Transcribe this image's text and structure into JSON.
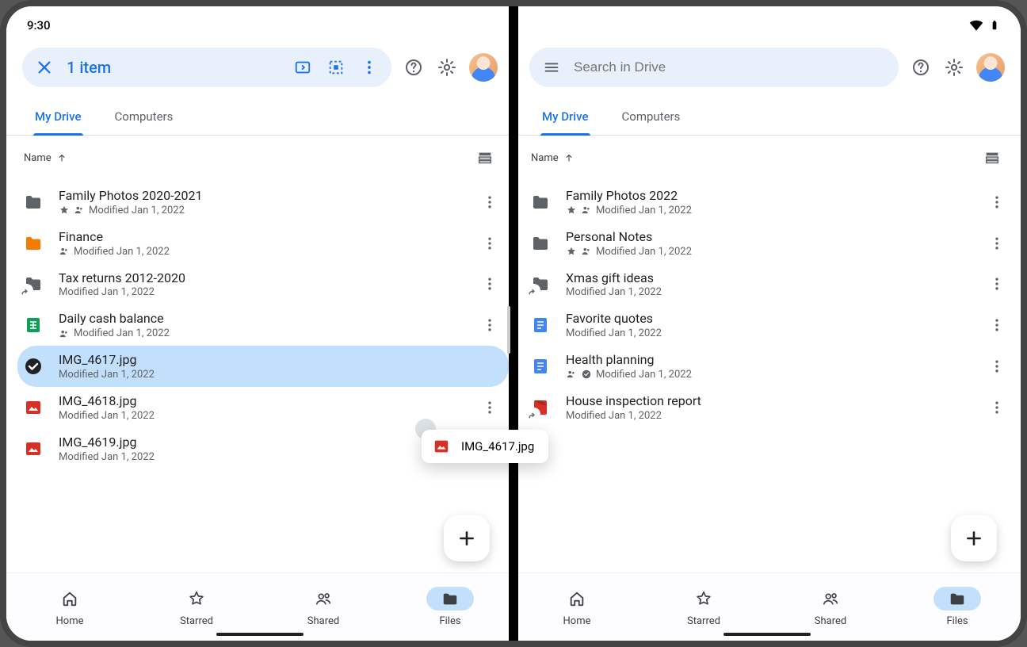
{
  "status": {
    "time": "9:30"
  },
  "left": {
    "selection": {
      "count_label": "1 item"
    },
    "tabs": {
      "drive": "My Drive",
      "computers": "Computers",
      "active": "drive"
    },
    "sort": {
      "label": "Name"
    },
    "files": [
      {
        "title": "Family Photos 2020-2021",
        "sub": "Modified Jan 1, 2022",
        "starred": true,
        "shared": true,
        "type": "folder-grey"
      },
      {
        "title": "Finance",
        "sub": "Modified Jan 1, 2022",
        "starred": false,
        "shared": true,
        "type": "folder-orange"
      },
      {
        "title": "Tax returns 2012-2020",
        "sub": "Modified Jan 1, 2022",
        "starred": false,
        "shared": false,
        "type": "folder-shortcut"
      },
      {
        "title": "Daily cash balance",
        "sub": "Modified Jan 1, 2022",
        "starred": false,
        "shared": true,
        "type": "sheet"
      },
      {
        "title": "IMG_4617.jpg",
        "sub": "Modified Jan 1, 2022",
        "starred": false,
        "shared": false,
        "type": "selected",
        "selected": true
      },
      {
        "title": "IMG_4618.jpg",
        "sub": "Modified Jan 1, 2022",
        "starred": false,
        "shared": false,
        "type": "image"
      },
      {
        "title": "IMG_4619.jpg",
        "sub": "Modified Jan 1, 2022",
        "starred": false,
        "shared": false,
        "type": "image"
      }
    ]
  },
  "right": {
    "search": {
      "placeholder": "Search in Drive"
    },
    "tabs": {
      "drive": "My Drive",
      "computers": "Computers",
      "active": "drive"
    },
    "sort": {
      "label": "Name"
    },
    "files": [
      {
        "title": "Family Photos 2022",
        "sub": "Modified Jan 1, 2022",
        "starred": true,
        "shared": true,
        "type": "folder-grey"
      },
      {
        "title": "Personal Notes",
        "sub": "Modified Jan 1, 2022",
        "starred": true,
        "shared": true,
        "type": "folder-grey"
      },
      {
        "title": "Xmas gift ideas",
        "sub": "Modified Jan 1, 2022",
        "starred": false,
        "shared": false,
        "type": "folder-shortcut"
      },
      {
        "title": "Favorite quotes",
        "sub": "Modified Jan 1, 2022",
        "starred": false,
        "shared": false,
        "type": "doc"
      },
      {
        "title": "Health planning",
        "sub": "Modified Jan 1, 2022",
        "starred": false,
        "shared": true,
        "offline": true,
        "type": "doc"
      },
      {
        "title": "House inspection report",
        "sub": "Modified Jan 1, 2022",
        "starred": false,
        "shared": false,
        "type": "pdf-shortcut"
      }
    ]
  },
  "drag": {
    "label": "IMG_4617.jpg"
  },
  "nav": {
    "home": "Home",
    "starred": "Starred",
    "shared": "Shared",
    "files": "Files",
    "active": "files"
  }
}
